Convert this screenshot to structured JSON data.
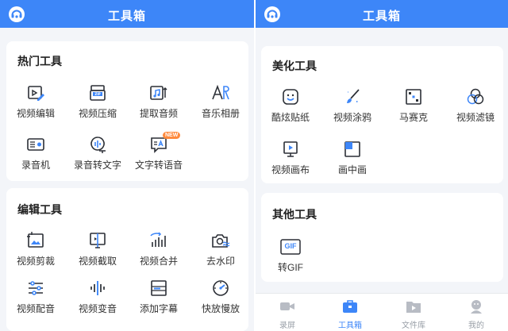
{
  "left": {
    "header": {
      "title": "工具箱"
    },
    "hot": {
      "title": "热门工具",
      "items": [
        {
          "label": "视频编辑"
        },
        {
          "label": "视频压缩"
        },
        {
          "label": "提取音频"
        },
        {
          "label": "音乐相册"
        },
        {
          "label": "录音机"
        },
        {
          "label": "录音转文字"
        },
        {
          "label": "文字转语音",
          "badge": "NEW"
        }
      ]
    },
    "edit": {
      "title": "编辑工具",
      "items": [
        {
          "label": "视频剪裁"
        },
        {
          "label": "视频截取"
        },
        {
          "label": "视频合并"
        },
        {
          "label": "去水印"
        },
        {
          "label": "视频配音"
        },
        {
          "label": "视频变音"
        },
        {
          "label": "添加字幕"
        },
        {
          "label": "快放慢放"
        }
      ]
    }
  },
  "right": {
    "header": {
      "title": "工具箱"
    },
    "beauty": {
      "title": "美化工具",
      "items": [
        {
          "label": "酷炫贴纸"
        },
        {
          "label": "视频涂鸦"
        },
        {
          "label": "马赛克"
        },
        {
          "label": "视频滤镜"
        },
        {
          "label": "视频画布"
        },
        {
          "label": "画中画"
        }
      ]
    },
    "other": {
      "title": "其他工具",
      "items": [
        {
          "label": "转GIF",
          "icon_text": "GIF"
        }
      ]
    },
    "tabbar": {
      "tabs": [
        {
          "label": "录屏",
          "active": false
        },
        {
          "label": "工具箱",
          "active": true
        },
        {
          "label": "文件库",
          "active": false
        },
        {
          "label": "我的",
          "active": false
        }
      ]
    }
  },
  "colors": {
    "accent": "#3d86f8",
    "badge": "#ff8a3d",
    "icon": "#2b2f36",
    "inactive": "#b8bcc4"
  }
}
